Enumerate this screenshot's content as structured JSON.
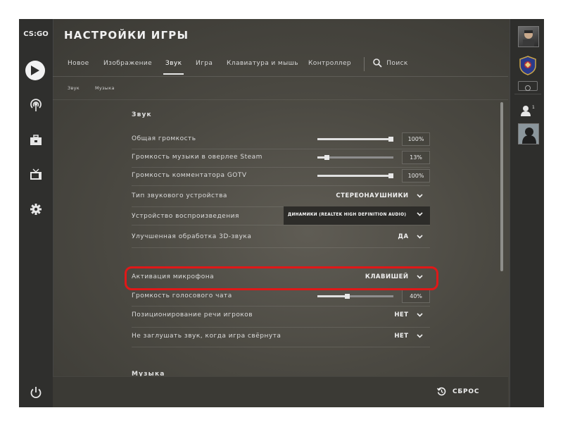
{
  "app": {
    "logo_text": "CS:GO",
    "title": "НАСТРОЙКИ ИГРЫ"
  },
  "tabs": [
    {
      "label": "Новое"
    },
    {
      "label": "Изображение"
    },
    {
      "label": "Звук",
      "active": true
    },
    {
      "label": "Игра"
    },
    {
      "label": "Клавиатура и мышь"
    },
    {
      "label": "Контроллер"
    }
  ],
  "search": {
    "label": "Поиск",
    "icon": "search-icon"
  },
  "subtabs": [
    {
      "label": "Звук"
    },
    {
      "label": "Музыка"
    }
  ],
  "left_nav": [
    {
      "icon": "play-icon"
    },
    {
      "icon": "broadcast-icon"
    },
    {
      "icon": "inventory-icon"
    },
    {
      "icon": "tv-icon"
    },
    {
      "icon": "settings-gear-icon"
    },
    {
      "icon": "power-icon"
    }
  ],
  "sections": {
    "sound": {
      "title": "Звук",
      "rows": [
        {
          "label": "Общая громкость",
          "type": "slider",
          "value": "100%",
          "level": 1.0
        },
        {
          "label": "Громкость музыки в оверлее Steam",
          "type": "slider",
          "value": "13%",
          "level": 0.13
        },
        {
          "label": "Громкость комментатора GOTV",
          "type": "slider",
          "value": "100%",
          "level": 1.0
        },
        {
          "label": "Тип звукового устройства",
          "type": "dropdown",
          "value": "СТЕРЕОНАУШНИКИ"
        },
        {
          "label": "Устройство воспроизведения",
          "type": "dropdown",
          "value": "ДИНАМИКИ (REALTEK HIGH DEFINITION AUDIO)"
        },
        {
          "label": "Улучшенная обработка 3D-звука",
          "type": "dropdown",
          "value": "ДА"
        },
        {
          "label": "Активация микрофона",
          "type": "dropdown",
          "value": "КЛАВИШЕЙ",
          "highlighted": true
        },
        {
          "label": "Громкость голосового чата",
          "type": "slider",
          "value": "40%",
          "level": 0.4
        },
        {
          "label": "Позиционирование речи игроков",
          "type": "dropdown",
          "value": "НЕТ"
        },
        {
          "label": "Не заглушать звук, когда игра свёрнута",
          "type": "dropdown",
          "value": "НЕТ"
        }
      ]
    },
    "music": {
      "title": "Музыка"
    }
  },
  "bottom": {
    "reset_label": "СБРОС"
  },
  "colors": {
    "highlight": "#e01818",
    "panel": "#4b4942",
    "sidebar": "#2f2f2d"
  }
}
